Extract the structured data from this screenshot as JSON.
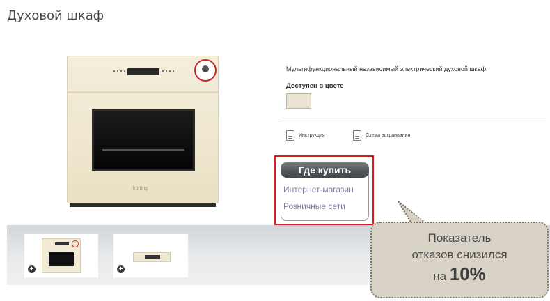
{
  "page": {
    "title": "Духовой шкаф"
  },
  "product": {
    "description": "Мультифункциональный независимый электрический духовой шкаф.",
    "available_colors_label": "Доступен в цвете",
    "color_swatch": "#ece4d2",
    "oven_logo": "körting"
  },
  "documents": {
    "instruction_label": "Инструкция",
    "scheme_label": "Схема встраивания"
  },
  "where_to_buy": {
    "button_label": "Где купить",
    "links": [
      "Интернет-магазин",
      "Розничные сети"
    ],
    "highlight_color": "#e01b1b"
  },
  "thumbnails": {
    "zoom_icon": "plus-circle-icon"
  },
  "callout": {
    "line1": "Показатель",
    "line2": "отказов снизился",
    "line3_prefix": "на",
    "line3_value": "10%"
  }
}
